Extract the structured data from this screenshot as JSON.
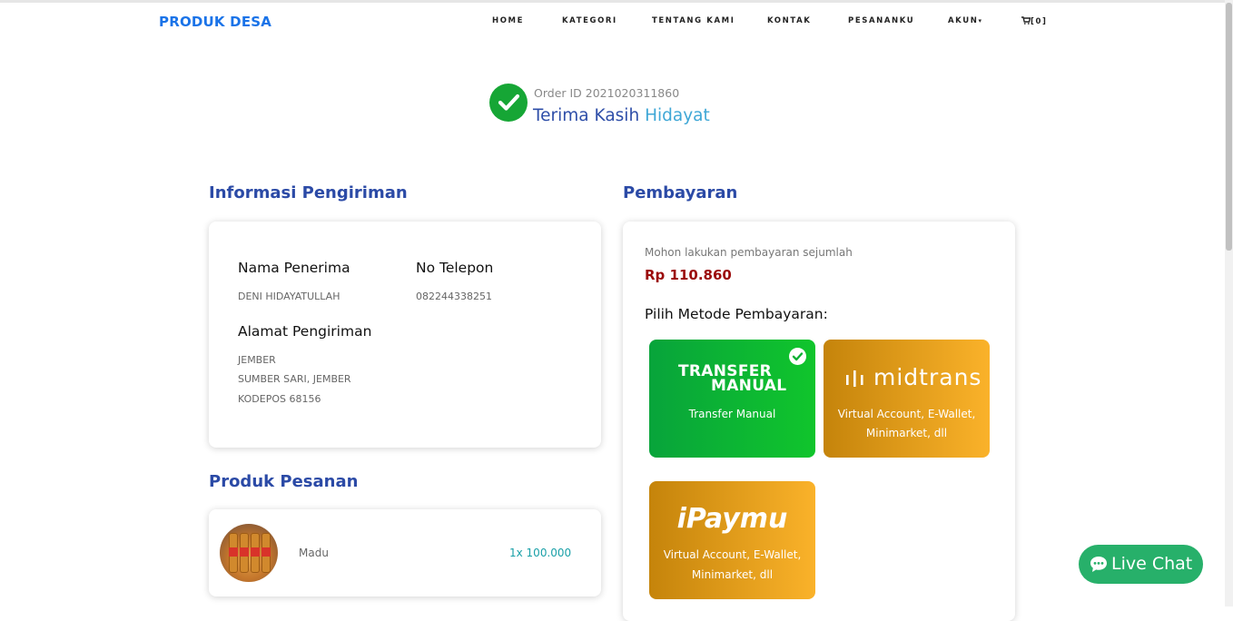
{
  "brand": "PRODUK DESA",
  "nav": {
    "home": "HOME",
    "kategori": "KATEGORI",
    "tentang": "TENTANG KAMI",
    "kontak": "KONTAK",
    "pesananku": "PESANANKU",
    "akun": "AKUN",
    "cart": "[0]"
  },
  "order": {
    "id_text": "Order ID 2021020311860",
    "thanks": "Terima Kasih",
    "name": "Hidayat"
  },
  "shipping": {
    "title": "Informasi Pengiriman",
    "recipient_label": "Nama Penerima",
    "recipient_value": "DENI HIDAYATULLAH",
    "phone_label": "No Telepon",
    "phone_value": "082244338251",
    "address_label": "Alamat Pengiriman",
    "address_lines": [
      "JEMBER",
      "SUMBER SARI, JEMBER",
      "KODEPOS 68156"
    ]
  },
  "payment": {
    "title": "Pembayaran",
    "note": "Mohon lakukan pembayaran sejumlah",
    "amount": "Rp 110.860",
    "method_title": "Pilih Metode Pembayaran:",
    "methods": [
      {
        "logo_line1": "TRANSFER",
        "logo_line2": "MANUAL",
        "desc": "Transfer Manual",
        "selected": true,
        "color": "#0bb033"
      },
      {
        "logo": "midtrans",
        "desc_line1": "Virtual Account, E-Wallet,",
        "desc_line2": "Minimarket, dll",
        "color": "#e09d1b"
      },
      {
        "logo": "iPaymu",
        "desc_line1": "Virtual Account, E-Wallet,",
        "desc_line2": "Minimarket, dll",
        "color": "#e09d1b"
      }
    ]
  },
  "products": {
    "title": "Produk Pesanan",
    "items": [
      {
        "name": "Madu",
        "qty": "1x 100.000"
      }
    ]
  },
  "livechat": "Live Chat",
  "colors": {
    "brand": "#1a73e8",
    "heading": "#2b4aa6",
    "amount": "#9b0b0b",
    "success": "#16a635",
    "chat": "#27b06a"
  }
}
